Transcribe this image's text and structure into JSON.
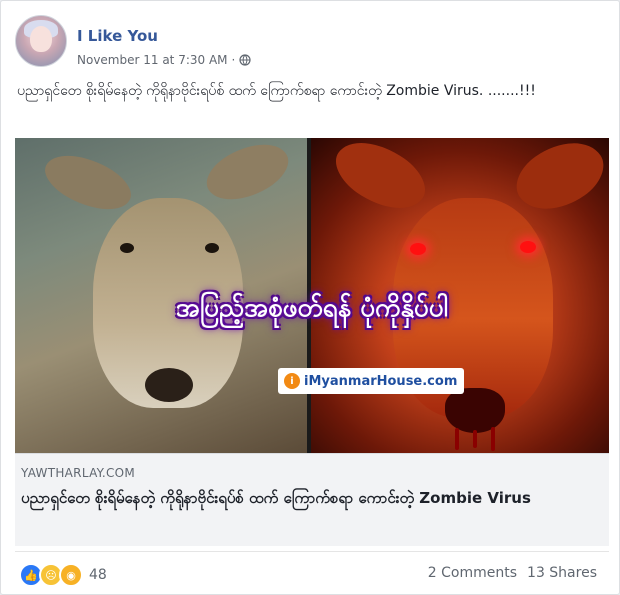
{
  "post": {
    "author": "I Like You",
    "timestamp": "November 11 at 7:30 AM",
    "separator": "·",
    "privacy_icon": "globe-icon",
    "text": "ပညာရှင်တေ စိုးရိမ်နေတဲ့ ကိုရိုနာဗိုင်းရပ်စ် ထက် ကြောက်စရာ ကောင်းတဲ့ Zombie Virus. .......!!!"
  },
  "image": {
    "caption": "အပြည့်အစုံဖတ်ရန် ပုံကိုနှိပ်ပါ",
    "watermark_prefix": "i",
    "watermark_text": "iMyanmarHouse.com"
  },
  "link": {
    "domain": "YAWTHARLAY.COM",
    "title": "ပညာရှင်တေ စိုးရိမ်နေတဲ့ ကိုရိုနာဗိုင်းရပ်စ် ထက် ကြောက်စရာ ကောင်းတဲ့ Zombie Virus"
  },
  "footer": {
    "reactions": [
      "like-icon",
      "sad-icon",
      "wow-icon"
    ],
    "reaction_count": "48",
    "comments": "2 Comments",
    "shares": "13 Shares"
  },
  "colors": {
    "author": "#365899",
    "meta": "#616770",
    "like": "#2a78f6"
  }
}
